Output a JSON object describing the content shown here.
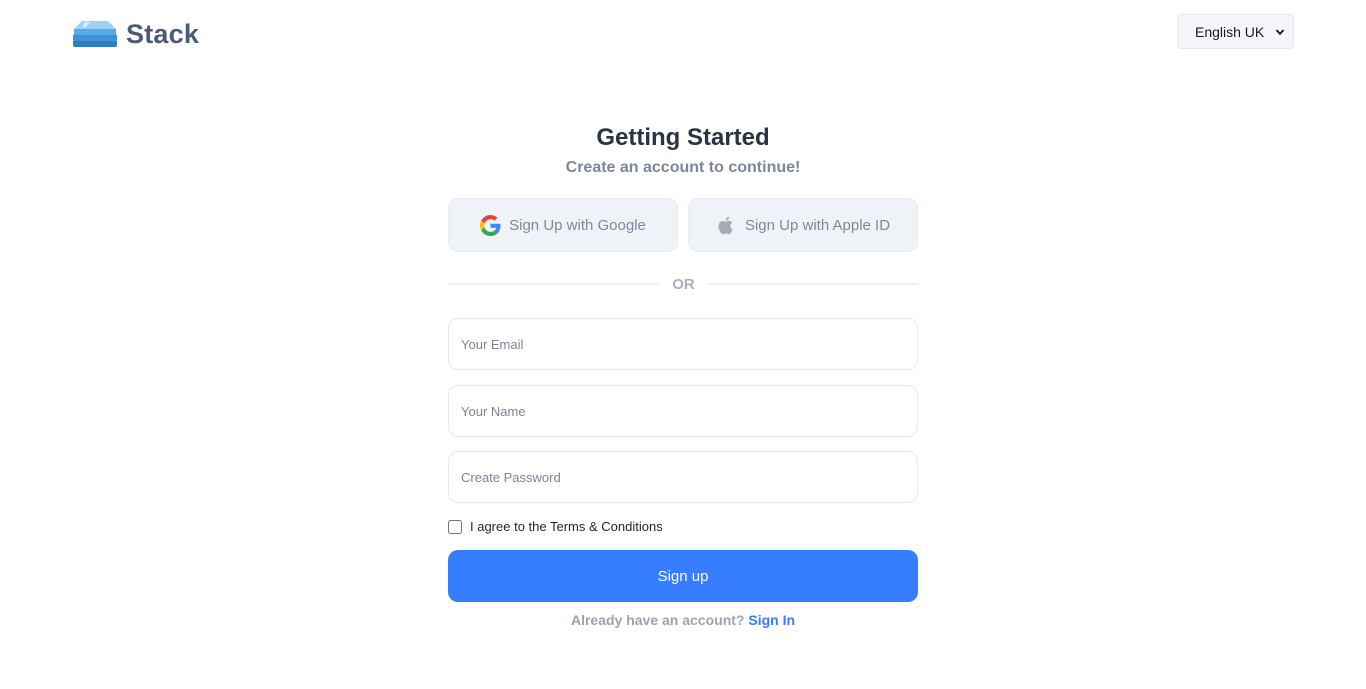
{
  "header": {
    "brand": "Stack",
    "language": "English UK"
  },
  "form": {
    "title": "Getting Started",
    "subtitle": "Create an account to continue!",
    "google_label": "Sign Up with Google",
    "apple_label": "Sign Up with Apple ID",
    "divider_text": "OR",
    "email_placeholder": "Your Email",
    "name_placeholder": "Your Name",
    "password_placeholder": "Create Password",
    "terms_label": "I agree to the Terms & Conditions",
    "submit_label": "Sign up",
    "signin_prompt": "Already have an account?",
    "signin_link": "Sign In"
  },
  "colors": {
    "primary": "#377dff",
    "brand_text": "#4a5b78",
    "heading": "#2b3444",
    "muted": "#7d8797"
  },
  "icons": {
    "logo": "stack-logo-icon",
    "google": "google-icon",
    "apple": "apple-icon",
    "dropdown": "chevron-down-icon"
  }
}
